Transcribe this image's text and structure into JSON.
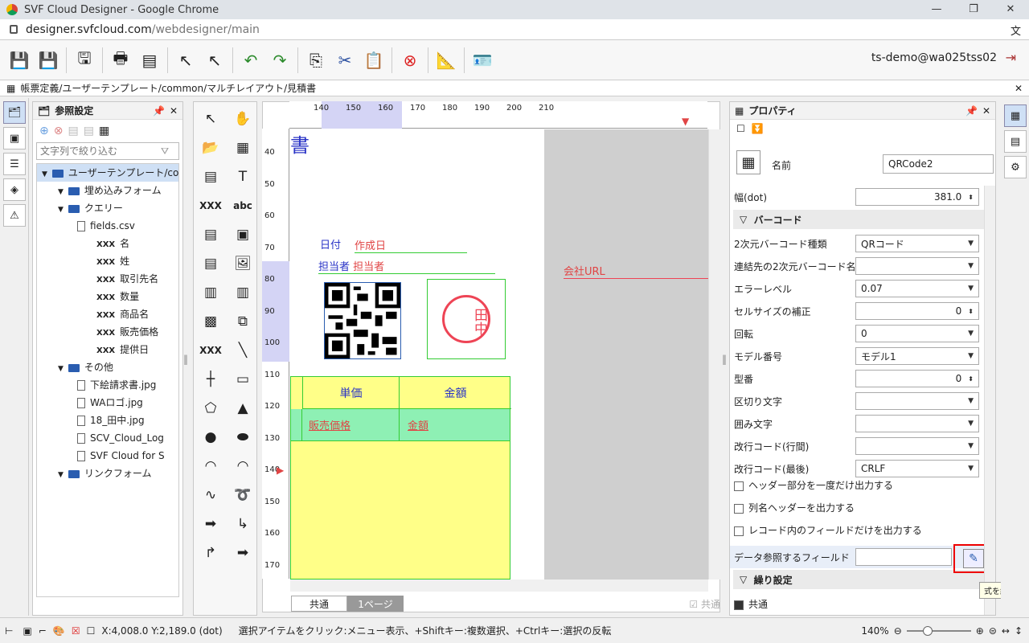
{
  "browser": {
    "title": "SVF Cloud Designer - Google Chrome",
    "url_host": "designer.svfcloud.com",
    "url_path": "/webdesigner/main"
  },
  "toolbar": {
    "user": "ts-demo@wa025tss02"
  },
  "path": "帳票定義/ユーザーテンプレート/common/マルチレイアウト/見積書",
  "ref_panel": {
    "title": "参照設定",
    "filter_placeholder": "文字列で絞り込む",
    "tree": [
      {
        "label": "ユーザーテンプレート/comm",
        "level": 1,
        "kind": "folder",
        "selected": true
      },
      {
        "label": "埋め込みフォーム",
        "level": 2,
        "kind": "folder"
      },
      {
        "label": "クエリー",
        "level": 2,
        "kind": "folder"
      },
      {
        "label": "fields.csv",
        "level": 3,
        "kind": "doc"
      },
      {
        "label": "名",
        "level": 4,
        "kind": "field"
      },
      {
        "label": "姓",
        "level": 4,
        "kind": "field"
      },
      {
        "label": "取引先名",
        "level": 4,
        "kind": "field"
      },
      {
        "label": "数量",
        "level": 4,
        "kind": "field"
      },
      {
        "label": "商品名",
        "level": 4,
        "kind": "field"
      },
      {
        "label": "販売価格",
        "level": 4,
        "kind": "field"
      },
      {
        "label": "提供日",
        "level": 4,
        "kind": "field"
      },
      {
        "label": "その他",
        "level": 2,
        "kind": "folder"
      },
      {
        "label": "下絵請求書.jpg",
        "level": 3,
        "kind": "doc"
      },
      {
        "label": "WAロゴ.jpg",
        "level": 3,
        "kind": "doc"
      },
      {
        "label": "18_田中.jpg",
        "level": 3,
        "kind": "doc"
      },
      {
        "label": "SCV_Cloud_Log",
        "level": 3,
        "kind": "doc"
      },
      {
        "label": "SVF Cloud for S",
        "level": 3,
        "kind": "doc"
      },
      {
        "label": "リンクフォーム",
        "level": 2,
        "kind": "folder"
      }
    ]
  },
  "ruler": {
    "h": [
      "140",
      "150",
      "160",
      "170",
      "180",
      "190",
      "200",
      "210"
    ],
    "v": [
      "40",
      "50",
      "60",
      "70",
      "80",
      "90",
      "100",
      "110",
      "120",
      "130",
      "140",
      "150",
      "160",
      "170"
    ]
  },
  "canvas": {
    "title_char": "書",
    "date_label": "日付",
    "date_field": "作成日",
    "person_label": "担当者",
    "person_field": "担当者",
    "url_field": "会社URL",
    "stamp": "田中",
    "col1": "単価",
    "col2": "金額",
    "f1": "販売価格",
    "f2": "金額",
    "tab_common": "共通",
    "tab_page": "1ページ",
    "common_chk": "共通"
  },
  "props": {
    "title": "プロパティ",
    "name_label": "名前",
    "name_value": "QRCode2",
    "width_label": "幅(dot)",
    "width_value": "381.0",
    "sec_barcode": "バーコード",
    "rows": [
      {
        "label": "2次元バーコード種類",
        "value": "QRコード",
        "dd": true
      },
      {
        "label": "連結先の2次元バーコード名",
        "value": "",
        "dd": true
      },
      {
        "label": "エラーレベル",
        "value": "0.07",
        "dd": true
      },
      {
        "label": "セルサイズの補正",
        "value": "0",
        "dd": false
      },
      {
        "label": "回転",
        "value": "0",
        "dd": true
      },
      {
        "label": "モデル番号",
        "value": "モデル1",
        "dd": true
      },
      {
        "label": "型番",
        "value": "0",
        "dd": false
      },
      {
        "label": "区切り文字",
        "value": "",
        "dd": true
      },
      {
        "label": "囲み文字",
        "value": "",
        "dd": true
      },
      {
        "label": "改行コード(行間)",
        "value": "",
        "dd": true
      },
      {
        "label": "改行コード(最後)",
        "value": "CRLF",
        "dd": true
      }
    ],
    "checks": [
      "ヘッダー部分を一度だけ出力する",
      "列名ヘッダーを出力する",
      "レコード内のフィールドだけを出力する"
    ],
    "data_ref_label": "データ参照するフィールド",
    "sec_repeat": "繰り設定",
    "common_label": "共通",
    "tooltip": "式を編集"
  },
  "status": {
    "coords": "X:4,008.0 Y:2,189.0  (dot)",
    "hint": "選択アイテムをクリック:メニュー表示、+Shiftキー:複数選択、+Ctrlキー:選択の反転",
    "zoom": "140%"
  }
}
